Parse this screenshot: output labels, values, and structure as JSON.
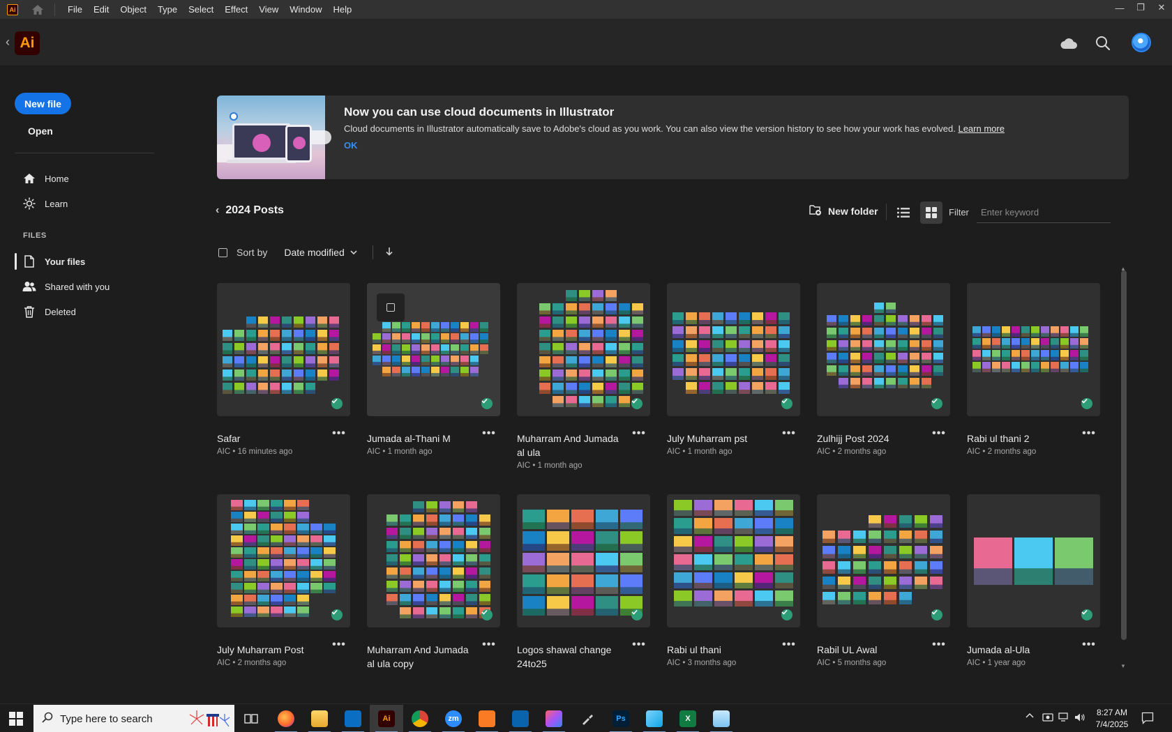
{
  "menubar": {
    "app_badge": "Ai",
    "items": [
      "File",
      "Edit",
      "Object",
      "Type",
      "Select",
      "Effect",
      "View",
      "Window",
      "Help"
    ]
  },
  "header": {
    "logo": "Ai",
    "icons": [
      "cloud-icon",
      "search-icon",
      "avatar"
    ]
  },
  "sidebar": {
    "new_file": "New file",
    "open": "Open",
    "nav": [
      {
        "label": "Home",
        "icon": "home-icon"
      },
      {
        "label": "Learn",
        "icon": "lightbulb-icon"
      }
    ],
    "files_header": "FILES",
    "files_nav": [
      {
        "label": "Your files",
        "icon": "file-icon",
        "active": true
      },
      {
        "label": "Shared with you",
        "icon": "people-icon"
      },
      {
        "label": "Deleted",
        "icon": "trash-icon"
      }
    ]
  },
  "banner": {
    "title": "Now you can use cloud documents in Illustrator",
    "text": "Cloud documents in Illustrator automatically save to Adobe's cloud as you work. You can also view the version history to see how your work has evolved.",
    "link": "Learn more",
    "ok": "OK"
  },
  "folder": {
    "title": "2024 Posts",
    "new_folder": "New folder",
    "filter_label": "Filter",
    "filter_placeholder": "Enter keyword",
    "sort_label": "Sort by",
    "sort_value": "Date modified"
  },
  "files": [
    {
      "name": "Safar",
      "meta": "AIC • 16 minutes ago"
    },
    {
      "name": "Jumada al-Thani M",
      "meta": "AIC • 1 month ago"
    },
    {
      "name": "Muharram And Jumada al ula",
      "meta": "AIC • 1 month ago"
    },
    {
      "name": "July Muharram pst",
      "meta": "AIC • 1 month ago"
    },
    {
      "name": "Zulhijj Post 2024",
      "meta": "AIC • 2 months ago"
    },
    {
      "name": "Rabi ul thani 2",
      "meta": "AIC • 2 months ago"
    },
    {
      "name": "July Muharram Post",
      "meta": "AIC • 2 months ago"
    },
    {
      "name": "Muharram And Jumada al ula copy",
      "meta": ""
    },
    {
      "name": "Logos shawal change 24to25",
      "meta": ""
    },
    {
      "name": "Rabi ul thani",
      "meta": "AIC • 3 months ago"
    },
    {
      "name": "Rabil UL Awal",
      "meta": "AIC • 5 months ago"
    },
    {
      "name": "Jumada al-Ula",
      "meta": "AIC • 1 year ago"
    }
  ],
  "taskbar": {
    "search_placeholder": "Type here to search",
    "apps": [
      {
        "icon": "task-view-icon"
      },
      {
        "icon": "firefox-icon"
      },
      {
        "icon": "file-explorer-icon"
      },
      {
        "icon": "vscode-icon"
      },
      {
        "icon": "illustrator-icon",
        "label": "Ai"
      },
      {
        "icon": "chrome-icon"
      },
      {
        "icon": "zoom-icon",
        "label": "zm"
      },
      {
        "icon": "xampp-icon"
      },
      {
        "icon": "outlook-icon"
      },
      {
        "icon": "creative-cloud-icon"
      },
      {
        "icon": "pen-tool-icon"
      },
      {
        "icon": "photoshop-icon",
        "label": "Ps"
      },
      {
        "icon": "app-icon"
      },
      {
        "icon": "excel-icon",
        "label": "X"
      },
      {
        "icon": "notepad-icon"
      }
    ],
    "time": "8:27 AM",
    "date": "7/4/2025"
  },
  "colors": {
    "accent": "#1473e6",
    "sync_ok": "#2d9d78",
    "ai_brand": "#ff9a00"
  }
}
